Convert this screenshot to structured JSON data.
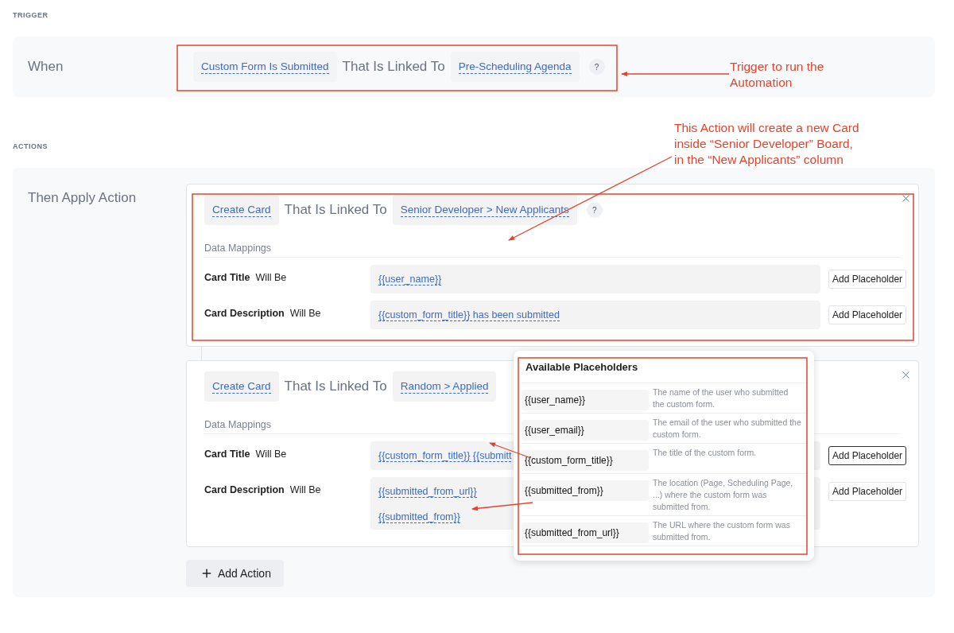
{
  "trigger": {
    "section_label": "TRIGGER",
    "label": "When",
    "event": "Custom Form Is Submitted",
    "connector": "That Is Linked To",
    "target": "Pre-Scheduling Agenda",
    "help": "?"
  },
  "actions": {
    "section_label": "ACTIONS",
    "label": "Then Apply Action",
    "items": [
      {
        "action": "Create Card",
        "connector": "That Is Linked To",
        "target": "Senior Developer > New Applicants",
        "help": "?",
        "mappings_title": "Data Mappings",
        "mappings": [
          {
            "field": "Card Title",
            "verb": "Will Be",
            "values": [
              "{{user_name}}"
            ],
            "button": "Add Placeholder",
            "active": false
          },
          {
            "field": "Card Description",
            "verb": "Will Be",
            "values": [
              "{{custom_form_title}} has been submitted"
            ],
            "button": "Add Placeholder",
            "active": false
          }
        ]
      },
      {
        "action": "Create Card",
        "connector": "That Is Linked To",
        "target": "Random > Applied",
        "mappings_title": "Data Mappings",
        "mappings": [
          {
            "field": "Card Title",
            "verb": "Will Be",
            "values": [
              "{{custom_form_title}} {{submitt"
            ],
            "button": "Add Placeholder",
            "active": true
          },
          {
            "field": "Card Description",
            "verb": "Will Be",
            "values": [
              "{{submitted_from_url}}",
              "{{submitted_from}}"
            ],
            "button": "Add Placeholder",
            "active": false
          }
        ]
      }
    ],
    "add_button": "Add Action"
  },
  "popover": {
    "title": "Available Placeholders",
    "items": [
      {
        "token": "{{user_name}}",
        "description": "The name of the user who submitted the custom form."
      },
      {
        "token": "{{user_email}}",
        "description": "The email of the user who submitted the custom form."
      },
      {
        "token": "{{custom_form_title}}",
        "description": "The title of the custom form."
      },
      {
        "token": "{{submitted_from}}",
        "description": "The location (Page, Scheduling Page, ...) where the custom form was submitted from."
      },
      {
        "token": "{{submitted_from_url}}",
        "description": "The URL where the custom form was submitted from."
      }
    ]
  },
  "annotations": {
    "notes": [
      "Trigger to run the\nAutomation",
      "This Action will create a new Card\ninside “Senior Developer” Board,\nin the “New Applicants” column"
    ]
  }
}
